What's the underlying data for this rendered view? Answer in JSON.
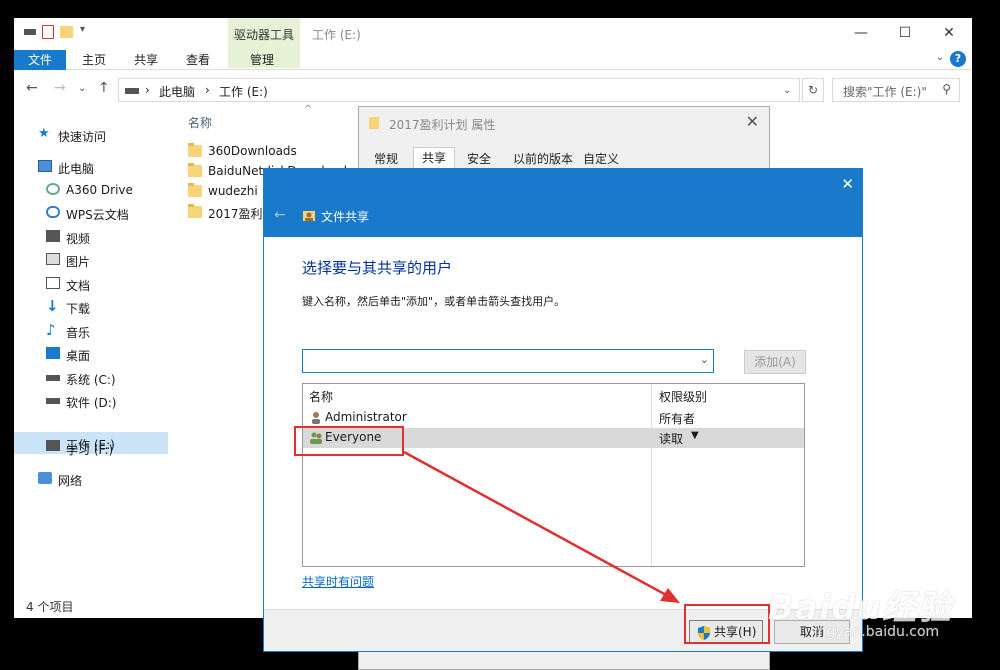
{
  "explorer": {
    "title": "工作 (E:)",
    "contextual_tab": "驱动器工具",
    "ribbon_tabs": [
      "文件",
      "主页",
      "共享",
      "查看",
      "管理"
    ],
    "address": [
      "此电脑",
      "工作 (E:)"
    ],
    "search_placeholder": "搜索\"工作 (E:)\"",
    "nav": [
      {
        "label": "快速访问",
        "icon": "star-icon"
      },
      {
        "label": "此电脑",
        "icon": "computer-icon"
      },
      {
        "label": "A360 Drive",
        "icon": "cloud-drive-icon"
      },
      {
        "label": "WPS云文档",
        "icon": "cloud-icon"
      },
      {
        "label": "视频",
        "icon": "video-icon"
      },
      {
        "label": "图片",
        "icon": "picture-icon"
      },
      {
        "label": "文档",
        "icon": "document-icon"
      },
      {
        "label": "下载",
        "icon": "download-icon"
      },
      {
        "label": "音乐",
        "icon": "music-icon"
      },
      {
        "label": "桌面",
        "icon": "desktop-icon"
      },
      {
        "label": "系统 (C:)",
        "icon": "drive-icon"
      },
      {
        "label": "软件 (D:)",
        "icon": "drive-icon"
      },
      {
        "label": "工作 (E:)",
        "icon": "drive-icon"
      },
      {
        "label": "学习 (F:)",
        "icon": "drive-icon"
      },
      {
        "label": "网络",
        "icon": "network-icon"
      }
    ],
    "column_name": "名称",
    "files": [
      "360Downloads",
      "BaiduNetdiskDownload",
      "wudezhi",
      "2017盈利计划"
    ],
    "status": "4 个项目"
  },
  "properties": {
    "title": "2017盈利计划 属性",
    "tabs": [
      "常规",
      "共享",
      "安全",
      "以前的版本",
      "自定义"
    ]
  },
  "wizard": {
    "title": "文件共享",
    "heading": "选择要与其共享的用户",
    "instruction": "键入名称，然后单击\"添加\"，或者单击箭头查找用户。",
    "add_label": "添加(A)",
    "col_name": "名称",
    "col_perm": "权限级别",
    "users": [
      {
        "name": "Administrator",
        "perm": "所有者"
      },
      {
        "name": "Everyone",
        "perm": "读取"
      }
    ],
    "help_link": "共享时有问题",
    "share_label": "共享(H)",
    "cancel_label": "取消"
  },
  "watermark": {
    "brand": "Baidu经验",
    "url": "jingyan.baidu.com"
  },
  "colors": {
    "accent": "#1979ca",
    "annotation": "#e03030"
  }
}
